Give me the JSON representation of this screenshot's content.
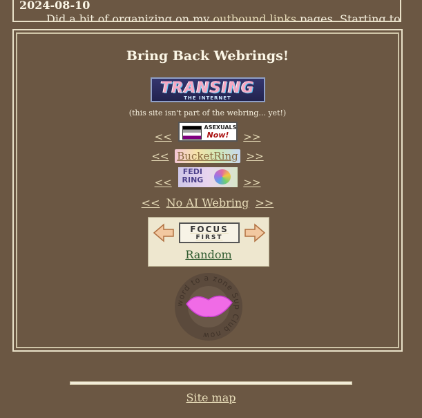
{
  "log": {
    "date": "2024-08-10",
    "line_prefix": "Did a bit of organizing on my ",
    "line_link": "outbound links",
    "line_suffix": " pages. Starting to get"
  },
  "webrings": {
    "title": "Bring Back Webrings!",
    "transing": {
      "logo_text": "TRANSING",
      "logo_subtext": "THE INTERNET",
      "note": "(this site isn't part of the webring... yet!)"
    },
    "prev_label": "<<",
    "next_label": ">>",
    "asexuals": {
      "line1": "ASEXUALS",
      "line2": "Now!"
    },
    "bucketring": "BucketRing",
    "fediring": {
      "line1": "FEDI",
      "line2": "RING"
    },
    "no_ai": "No AI Webring",
    "focus_first": {
      "line1": "FOCUS",
      "line2": "FIRST",
      "random": "Random"
    },
    "supclub_text": "word to a zone Sup Club now"
  },
  "footer": {
    "site_map": "Site map"
  },
  "colors": {
    "background": "#6b5743",
    "text": "#f4eedc",
    "link": "#e7dcb8",
    "focus_link": "#2f5b2f",
    "supclub_pink": "#f06be6"
  }
}
